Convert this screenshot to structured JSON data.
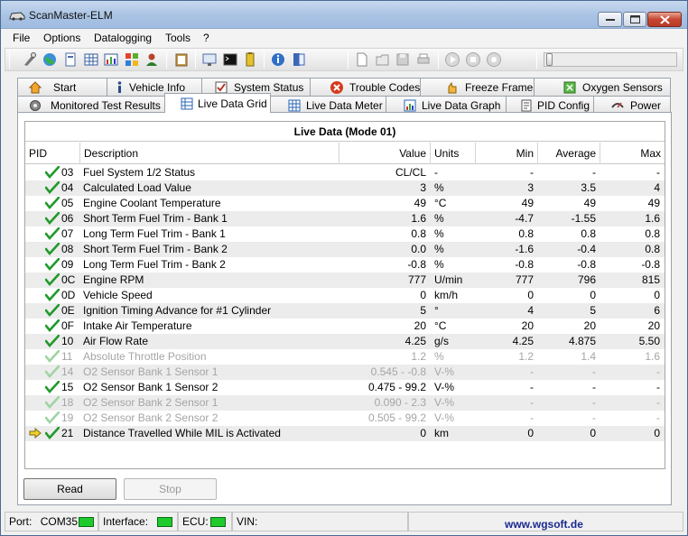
{
  "window": {
    "title": "ScanMaster-ELM"
  },
  "menu": [
    "File",
    "Options",
    "Datalogging",
    "Tools",
    "?"
  ],
  "tabs_top": [
    {
      "label": "Start",
      "icon": "home-icon"
    },
    {
      "label": "Vehicle Info",
      "icon": "info-icon"
    },
    {
      "label": "System Status",
      "icon": "status-icon"
    },
    {
      "label": "Trouble Codes",
      "icon": "trouble-codes-icon"
    },
    {
      "label": "Freeze Frames",
      "icon": "freeze-frame-icon"
    },
    {
      "label": "Oxygen Sensors",
      "icon": "oxygen-sensor-icon"
    }
  ],
  "tabs_bottom": [
    {
      "label": "Monitored Test Results",
      "icon": "gear-icon"
    },
    {
      "label": "Live Data Grid",
      "icon": "grid-icon"
    },
    {
      "label": "Live Data Meter",
      "icon": "meter-icon"
    },
    {
      "label": "Live Data Graph",
      "icon": "graph-icon"
    },
    {
      "label": "PID Config",
      "icon": "config-icon"
    },
    {
      "label": "Power",
      "icon": "power-icon"
    }
  ],
  "grid": {
    "title": "Live Data (Mode 01)",
    "columns": [
      "PID",
      "Description",
      "Value",
      "Units",
      "Min",
      "Average",
      "Max"
    ],
    "rows": [
      {
        "pid": "03",
        "desc": "Fuel System 1/2 Status",
        "value": "CL/CL",
        "units": "-",
        "min": "-",
        "avg": "-",
        "max": "-",
        "enabled": true,
        "pointer": false
      },
      {
        "pid": "04",
        "desc": "Calculated Load Value",
        "value": "3",
        "units": "%",
        "min": "3",
        "avg": "3.5",
        "max": "4",
        "enabled": true,
        "pointer": false
      },
      {
        "pid": "05",
        "desc": "Engine Coolant Temperature",
        "value": "49",
        "units": "°C",
        "min": "49",
        "avg": "49",
        "max": "49",
        "enabled": true,
        "pointer": false
      },
      {
        "pid": "06",
        "desc": "Short Term Fuel Trim - Bank 1",
        "value": "1.6",
        "units": "%",
        "min": "-4.7",
        "avg": "-1.55",
        "max": "1.6",
        "enabled": true,
        "pointer": false
      },
      {
        "pid": "07",
        "desc": "Long Term Fuel Trim - Bank 1",
        "value": "0.8",
        "units": "%",
        "min": "0.8",
        "avg": "0.8",
        "max": "0.8",
        "enabled": true,
        "pointer": false
      },
      {
        "pid": "08",
        "desc": "Short Term Fuel Trim - Bank 2",
        "value": "0.0",
        "units": "%",
        "min": "-1.6",
        "avg": "-0.4",
        "max": "0.8",
        "enabled": true,
        "pointer": false
      },
      {
        "pid": "09",
        "desc": "Long Term Fuel Trim - Bank 2",
        "value": "-0.8",
        "units": "%",
        "min": "-0.8",
        "avg": "-0.8",
        "max": "-0.8",
        "enabled": true,
        "pointer": false
      },
      {
        "pid": "0C",
        "desc": "Engine RPM",
        "value": "777",
        "units": "U/min",
        "min": "777",
        "avg": "796",
        "max": "815",
        "enabled": true,
        "pointer": false
      },
      {
        "pid": "0D",
        "desc": "Vehicle Speed",
        "value": "0",
        "units": "km/h",
        "min": "0",
        "avg": "0",
        "max": "0",
        "enabled": true,
        "pointer": false
      },
      {
        "pid": "0E",
        "desc": "Ignition Timing Advance for #1 Cylinder",
        "value": "5",
        "units": "°",
        "min": "4",
        "avg": "5",
        "max": "6",
        "enabled": true,
        "pointer": false
      },
      {
        "pid": "0F",
        "desc": "Intake Air Temperature",
        "value": "20",
        "units": "°C",
        "min": "20",
        "avg": "20",
        "max": "20",
        "enabled": true,
        "pointer": false
      },
      {
        "pid": "10",
        "desc": "Air Flow Rate",
        "value": "4.25",
        "units": "g/s",
        "min": "4.25",
        "avg": "4.875",
        "max": "5.50",
        "enabled": true,
        "pointer": false
      },
      {
        "pid": "11",
        "desc": "Absolute Throttle Position",
        "value": "1.2",
        "units": "%",
        "min": "1.2",
        "avg": "1.4",
        "max": "1.6",
        "enabled": false,
        "pointer": false
      },
      {
        "pid": "14",
        "desc": "O2 Sensor Bank 1 Sensor 1",
        "value": "0.545 - -0.8",
        "units": "V-%",
        "min": "-",
        "avg": "-",
        "max": "-",
        "enabled": false,
        "pointer": false
      },
      {
        "pid": "15",
        "desc": "O2 Sensor Bank 1 Sensor 2",
        "value": "0.475 - 99.2",
        "units": "V-%",
        "min": "-",
        "avg": "-",
        "max": "-",
        "enabled": true,
        "pointer": false
      },
      {
        "pid": "18",
        "desc": "O2 Sensor Bank 2 Sensor 1",
        "value": "0.090 - 2.3",
        "units": "V-%",
        "min": "-",
        "avg": "-",
        "max": "-",
        "enabled": false,
        "pointer": false
      },
      {
        "pid": "19",
        "desc": "O2 Sensor Bank 2 Sensor 2",
        "value": "0.505 - 99.2",
        "units": "V-%",
        "min": "-",
        "avg": "-",
        "max": "-",
        "enabled": false,
        "pointer": false
      },
      {
        "pid": "21",
        "desc": "Distance Travelled While MIL is Activated",
        "value": "0",
        "units": "km",
        "min": "0",
        "avg": "0",
        "max": "0",
        "enabled": true,
        "pointer": true
      }
    ]
  },
  "buttons": {
    "read": "Read",
    "stop": "Stop"
  },
  "status": {
    "port_label": "Port:",
    "port_value": "COM35",
    "interface_label": "Interface:",
    "ecu_label": "ECU:",
    "vin_label": "VIN:",
    "website": "www.wgsoft.de",
    "led_color": "#1fca2d"
  }
}
